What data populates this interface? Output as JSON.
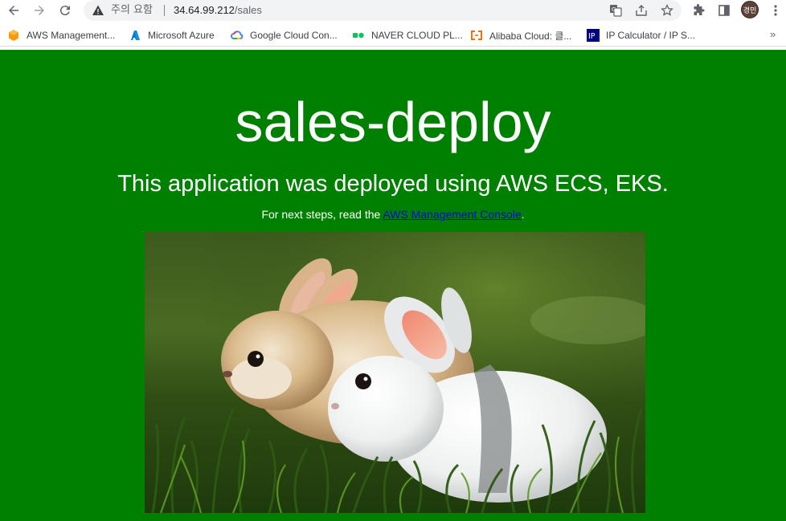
{
  "browser": {
    "security_label": "주의 요함",
    "url_host": "34.64.99.212",
    "url_path": "/sales",
    "profile_initials": "경민"
  },
  "bookmarks": [
    {
      "label": "AWS Management...",
      "icon": "aws-icon",
      "color": "#ff9900"
    },
    {
      "label": "Microsoft Azure",
      "icon": "azure-icon",
      "color": "#0078d4"
    },
    {
      "label": "Google Cloud Con...",
      "icon": "google-cloud-icon",
      "color": "#4285f4"
    },
    {
      "label": "NAVER CLOUD PL...",
      "icon": "naver-cloud-icon",
      "color": "#03c75a"
    },
    {
      "label": "Alibaba Cloud: 클...",
      "icon": "alibaba-cloud-icon",
      "color": "#ff6a00"
    },
    {
      "label": "IP Calculator / IP S...",
      "icon": "ip-calculator-icon",
      "color": "#000080"
    }
  ],
  "page": {
    "background": "#008000",
    "title": "sales-deploy",
    "subtitle": "This application was deployed using AWS ECS, EKS.",
    "note_prefix": "For next steps, read the ",
    "note_link": "AWS Management Console",
    "note_suffix": ".",
    "image": "two-rabbits-on-grass-photo"
  }
}
